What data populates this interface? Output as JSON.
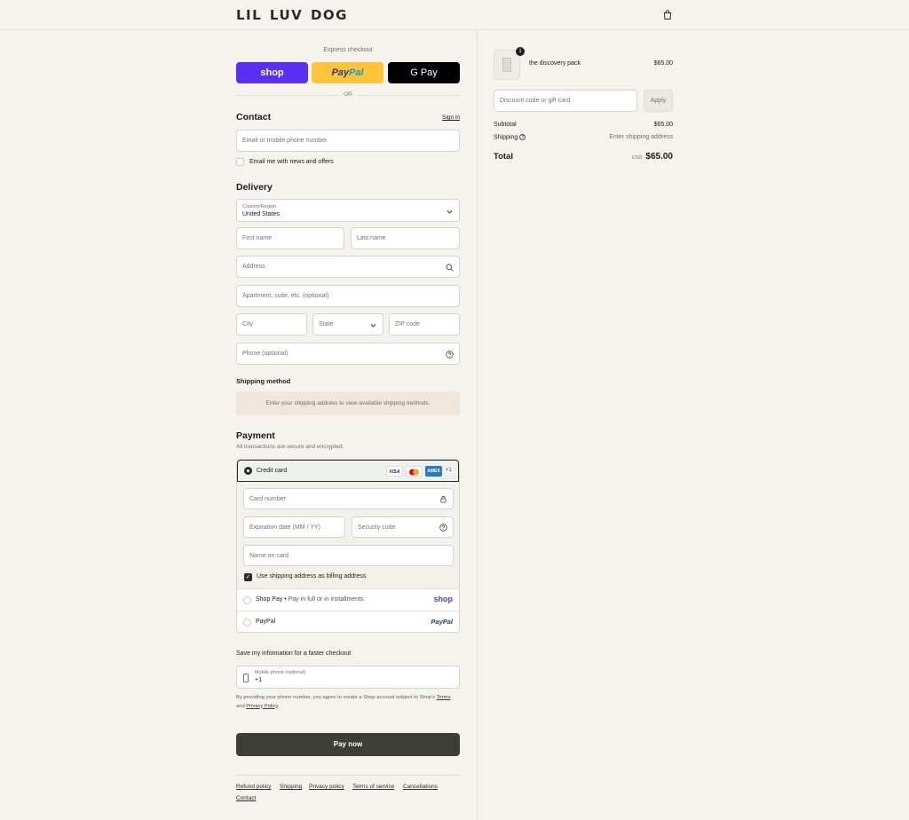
{
  "header": {
    "logo": "LIL LUV DOG",
    "cart_icon": "shopping-bag-icon"
  },
  "express": {
    "label": "Express checkout",
    "shop_label": "shop",
    "paypal_a": "Pay",
    "paypal_b": "Pal",
    "gpay_label": "G Pay",
    "or": "OR",
    "colors": {
      "shop": "#5a31f4",
      "paypal": "#ffc439",
      "gpay": "#000000"
    }
  },
  "contact": {
    "title": "Contact",
    "signin": "Sign in",
    "email_placeholder": "Email or mobile phone number",
    "news_label": "Email me with news and offers",
    "news_checked": false
  },
  "delivery": {
    "title": "Delivery",
    "country_label": "Country/Region",
    "country_value": "United States",
    "first_name": "First name",
    "last_name": "Last name",
    "address": "Address",
    "apartment": "Apartment, suite, etc. (optional)",
    "city": "City",
    "state": "State",
    "zip": "ZIP code",
    "phone": "Phone (optional)"
  },
  "shipping_method": {
    "title": "Shipping method",
    "note": "Enter your shipping address to view available shipping methods."
  },
  "payment": {
    "title": "Payment",
    "subtitle": "All transactions are secure and encrypted.",
    "credit_card": "Credit card",
    "card_logos": [
      "VISA",
      "mastercard",
      "AMEX",
      "+1"
    ],
    "more_cards": "+1",
    "card_number": "Card number",
    "expiration": "Expiration date (MM / YY)",
    "security_code": "Security code",
    "name_on_card": "Name on card",
    "billing_same": "Use shipping address as billing address",
    "billing_checked": true,
    "shoppay_label": "Shop Pay",
    "shoppay_desc": "Pay in full or in installments",
    "shoppay_logo": "shop",
    "paypal_label": "PayPal",
    "paypal_logo": "PayPal"
  },
  "save_info": {
    "title": "Save my information for a faster checkout",
    "phone_label": "Mobile phone (optional)",
    "phone_value": "+1",
    "legal_prefix": "By providing your phone number, you agree to create a Shop account subject to Shop's",
    "terms": "Terms",
    "and": "and",
    "privacy": "Privacy Policy",
    "period": "."
  },
  "pay_now": "Pay now",
  "footer_links": [
    "Refund policy",
    "Shipping",
    "Privacy policy",
    "Terms of service",
    "Cancellations",
    "Contact"
  ],
  "summary": {
    "product_name": "the discovery pack",
    "product_price": "$65.00",
    "quantity": "1",
    "discount_placeholder": "Discount code or gift card",
    "apply": "Apply",
    "subtotal_label": "Subtotal",
    "subtotal_value": "$65.00",
    "shipping_label": "Shipping",
    "shipping_value": "Enter shipping address",
    "total_label": "Total",
    "currency": "USD",
    "total_value": "$65.00"
  }
}
